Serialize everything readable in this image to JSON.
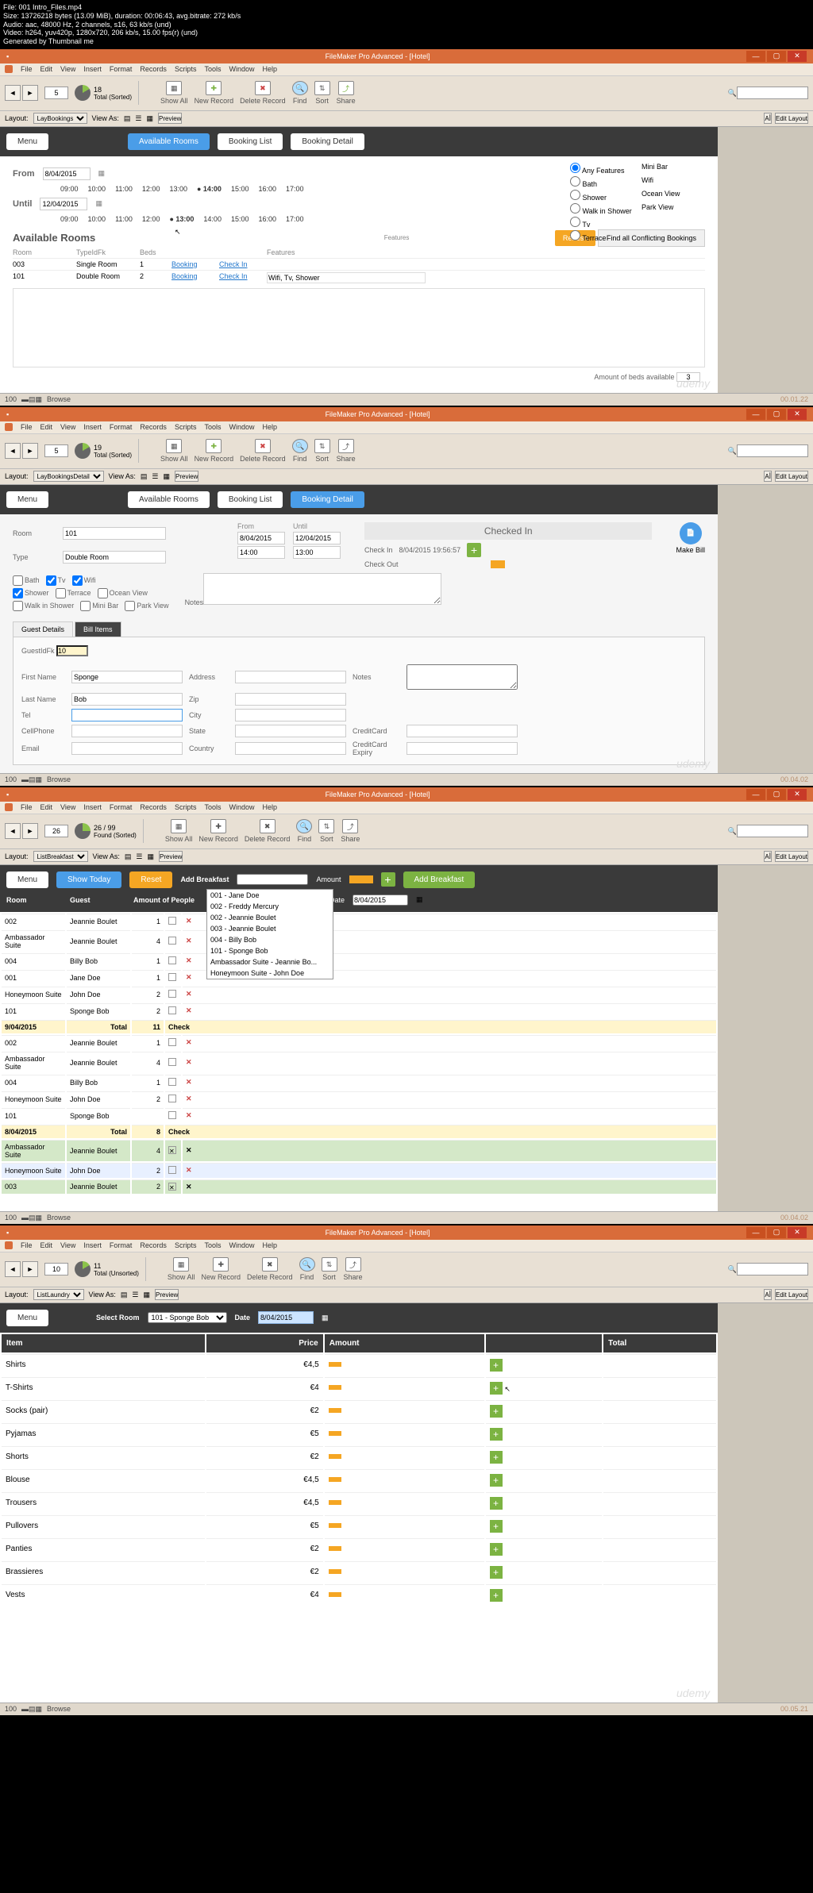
{
  "video_meta": [
    "File: 001 Intro_Files.mp4",
    "Size: 13726218 bytes (13.09 MiB), duration: 00:06:43, avg.bitrate: 272 kb/s",
    "Audio: aac, 48000 Hz, 2 channels, s16, 63 kb/s (und)",
    "Video: h264, yuv420p, 1280x720, 206 kb/s, 15.00 fps(r) (und)",
    "Generated by Thumbnail me"
  ],
  "app_title": "FileMaker Pro Advanced - [Hotel]",
  "menus": [
    "File",
    "Edit",
    "View",
    "Insert",
    "Format",
    "Records",
    "Scripts",
    "Tools",
    "Window",
    "Help"
  ],
  "tool_labels": {
    "showall": "Show All",
    "newrec": "New Record",
    "delrec": "Delete Record",
    "find": "Find",
    "sort": "Sort",
    "share": "Share"
  },
  "layoutbar": {
    "layout": "Layout:",
    "viewas": "View As:",
    "preview": "Preview",
    "editlayout": "Edit Layout"
  },
  "win1": {
    "rec": "5",
    "total": "18",
    "sorted": "Total (Sorted)",
    "layout": "LayBookings",
    "menu": "Menu",
    "avail": "Available Rooms",
    "blist": "Booking List",
    "bdetail": "Booking Detail",
    "from": "From",
    "until": "Until",
    "from_date": "8/04/2015",
    "until_date": "12/04/2015",
    "times": [
      "09:00",
      "10:00",
      "11:00",
      "12:00",
      "13:00",
      "14:00",
      "15:00",
      "16:00",
      "17:00"
    ],
    "features_title": "Features",
    "refresh": "Refresh",
    "conflict": "Find all Conflicting Bookings",
    "feats": [
      "Any Features",
      "Bath",
      "Shower",
      "Walk in Shower",
      "Tv",
      "Terrace"
    ],
    "feats2": [
      "Mini Bar",
      "Wifi",
      "Ocean View",
      "Park View"
    ],
    "avail_title": "Available Rooms",
    "th": [
      "Room",
      "TypeIdFk",
      "Beds",
      "",
      "",
      "Features"
    ],
    "rows": [
      {
        "room": "003",
        "type": "Single Room",
        "beds": "1",
        "b": "Booking",
        "c": "Check In",
        "feat": ""
      },
      {
        "room": "101",
        "type": "Double Room",
        "beds": "2",
        "b": "Booking",
        "c": "Check In",
        "feat": "Wifi, Tv, Shower"
      }
    ],
    "beds_label": "Amount of beds available",
    "beds_val": "3",
    "status": "100",
    "browse": "Browse",
    "ts": "00.01.22"
  },
  "win2": {
    "rec": "5",
    "total": "19",
    "sorted": "Total (Sorted)",
    "layout": "LayBookingsDetail",
    "checkedin": "Checked In",
    "from": "From",
    "until": "Until",
    "room_lbl": "Room",
    "room": "101",
    "type_lbl": "Type",
    "type": "Double Room",
    "from_date": "8/04/2015",
    "until_date": "12/04/2015",
    "from_time": "14:00",
    "until_time": "13:00",
    "checkin_lbl": "Check In",
    "checkin": "8/04/2015 19:56:57",
    "checkout_lbl": "Check Out",
    "opts1": [
      "Bath",
      "Shower",
      "Walk in Shower"
    ],
    "opts2": [
      "Tv",
      "Terrace",
      "Mini Bar"
    ],
    "opts3": [
      "Wifi",
      "Ocean View",
      "Park View"
    ],
    "notes": "Notes",
    "makebill": "Make Bill",
    "tab1": "Guest Details",
    "tab2": "Bill Items",
    "gid_lbl": "GuestIdFk",
    "gid": "10",
    "fn_lbl": "First Name",
    "fn": "Sponge",
    "ln_lbl": "Last Name",
    "ln": "Bob",
    "tel_lbl": "Tel",
    "cell_lbl": "CellPhone",
    "email_lbl": "Email",
    "addr": "Address",
    "zip": "Zip",
    "city": "City",
    "state": "State",
    "country": "Country",
    "notes2": "Notes",
    "cc": "CreditCard",
    "ccx": "CreditCard Expiry",
    "ts": "00.04.02"
  },
  "win3": {
    "rec": "26",
    "total": "26 / 99",
    "sorted": "Found (Sorted)",
    "layout": "ListBreakfast",
    "menu": "Menu",
    "showtoday": "Show Today",
    "reset": "Reset",
    "addbf": "Add Breakfast",
    "amount": "Amount",
    "date": "Date",
    "date_val": "8/04/2015",
    "addbtn": "Add Breakfast",
    "th": [
      "Room",
      "Guest",
      "Amount of People"
    ],
    "dropdown": [
      "001 - Jane Doe",
      "002 - Freddy Mercury",
      "002 - Jeannie Boulet",
      "003 - Jeannie Boulet",
      "004 - Billy Bob",
      "101 - Sponge Bob",
      "Ambassador Suite - Jeannie Bo...",
      "Honeymoon Suite - John Doe"
    ],
    "rows": [
      {
        "r": "002",
        "g": "Jeannie Boulet",
        "p": "1"
      },
      {
        "r": "Ambassador Suite",
        "g": "Jeannie Boulet",
        "p": "4"
      },
      {
        "r": "004",
        "g": "Billy Bob",
        "p": "1"
      },
      {
        "r": "001",
        "g": "Jane Doe",
        "p": "1"
      },
      {
        "r": "Honeymoon Suite",
        "g": "John Doe",
        "p": "2"
      },
      {
        "r": "101",
        "g": "Sponge Bob",
        "p": "2"
      }
    ],
    "total1": {
      "d": "9/04/2015",
      "t": "Total",
      "v": "11",
      "chk": "Check"
    },
    "rows2": [
      {
        "r": "002",
        "g": "Jeannie Boulet",
        "p": "1"
      },
      {
        "r": "Ambassador Suite",
        "g": "Jeannie Boulet",
        "p": "4"
      },
      {
        "r": "004",
        "g": "Billy Bob",
        "p": "1"
      },
      {
        "r": "Honeymoon Suite",
        "g": "John Doe",
        "p": "2"
      },
      {
        "r": "101",
        "g": "Sponge Bob",
        "p": ""
      }
    ],
    "total2": {
      "d": "8/04/2015",
      "t": "Total",
      "v": "8",
      "chk": "Check"
    },
    "rows3": [
      {
        "r": "Ambassador Suite",
        "g": "Jeannie Boulet",
        "p": "4",
        "done": true
      },
      {
        "r": "Honeymoon Suite",
        "g": "John Doe",
        "p": "2"
      },
      {
        "r": "003",
        "g": "Jeannie Boulet",
        "p": "2",
        "done": true
      }
    ],
    "ts": "00.04.02"
  },
  "win4": {
    "rec": "10",
    "total": "11",
    "sorted": "Total (Unsorted)",
    "layout": "ListLaundry",
    "menu": "Menu",
    "selroom": "Select Room",
    "room": "101 - Sponge Bob",
    "date": "Date",
    "date_val": "8/04/2015",
    "th": [
      "Item",
      "Price",
      "Amount",
      "Total"
    ],
    "rows": [
      {
        "i": "Shirts",
        "p": "€4,5"
      },
      {
        "i": "T-Shirts",
        "p": "€4"
      },
      {
        "i": "Socks (pair)",
        "p": "€2"
      },
      {
        "i": "Pyjamas",
        "p": "€5"
      },
      {
        "i": "Shorts",
        "p": "€2"
      },
      {
        "i": "Blouse",
        "p": "€4,5"
      },
      {
        "i": "Trousers",
        "p": "€4,5"
      },
      {
        "i": "Pullovers",
        "p": "€5"
      },
      {
        "i": "Panties",
        "p": "€2"
      },
      {
        "i": "Brassieres",
        "p": "€2"
      },
      {
        "i": "Vests",
        "p": "€4"
      }
    ],
    "ts": "00.05.21"
  }
}
